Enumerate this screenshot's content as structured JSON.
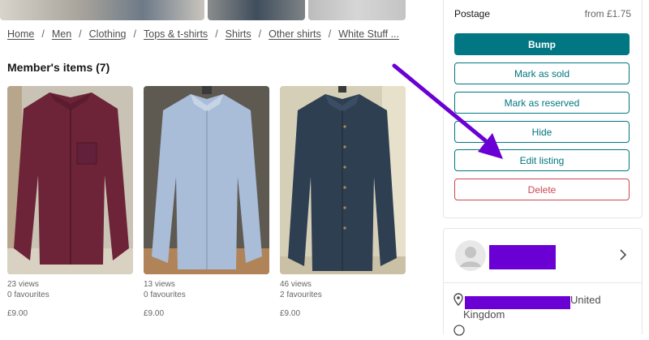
{
  "breadcrumb": [
    {
      "label": "Home"
    },
    {
      "label": "Men"
    },
    {
      "label": "Clothing"
    },
    {
      "label": "Tops & t-shirts"
    },
    {
      "label": "Shirts"
    },
    {
      "label": "Other shirts"
    },
    {
      "label": "White Stuff ..."
    }
  ],
  "breadcrumb_separator": "/",
  "members_items": {
    "title": "Member's items (7)",
    "items": [
      {
        "views": "23 views",
        "favourites": "0 favourites",
        "price": "£9.00",
        "photo": "burgundy-shirt"
      },
      {
        "views": "13 views",
        "favourites": "0 favourites",
        "price": "£9.00",
        "photo": "light-blue-shirt"
      },
      {
        "views": "46 views",
        "favourites": "2 favourites",
        "price": "£9.00",
        "photo": "navy-denim-shirt"
      }
    ]
  },
  "sidebar": {
    "postage_label": "Postage",
    "postage_value": "from £1.75",
    "buttons": {
      "bump": "Bump",
      "mark_sold": "Mark as sold",
      "mark_reserved": "Mark as reserved",
      "hide": "Hide",
      "edit": "Edit listing",
      "delete": "Delete"
    }
  },
  "member": {
    "location_suffix": "United",
    "location_line2": "Kingdom"
  },
  "colors": {
    "accent": "#007782",
    "danger": "#c7343f",
    "annotation_arrow": "#6a00d4",
    "redaction": "#6a00d4"
  },
  "icons": [
    "location-pin-icon",
    "chevron-right-icon",
    "avatar-placeholder-icon"
  ]
}
